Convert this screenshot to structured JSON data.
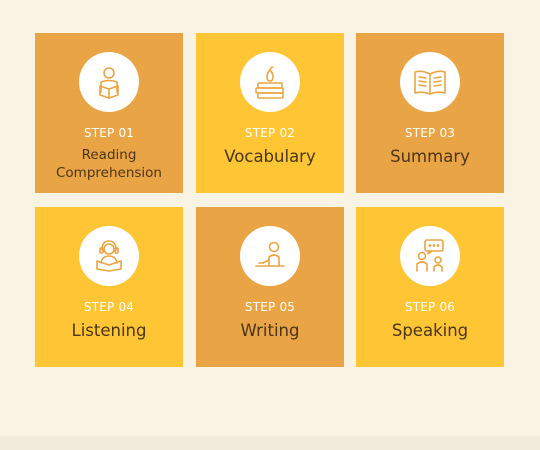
{
  "steps": [
    {
      "step": "STEP 01",
      "title_line1": "Reading",
      "title_line2": "Comprehension",
      "icon": "reading-person-icon",
      "color": "#e9a545"
    },
    {
      "step": "STEP 02",
      "title": "Vocabulary",
      "icon": "books-apple-icon",
      "color": "#fec535"
    },
    {
      "step": "STEP 03",
      "title": "Summary",
      "icon": "open-book-icon",
      "color": "#e9a545"
    },
    {
      "step": "STEP 04",
      "title": "Listening",
      "icon": "headphones-person-icon",
      "color": "#fec535"
    },
    {
      "step": "STEP 05",
      "title": "Writing",
      "icon": "writing-person-icon",
      "color": "#e9a545"
    },
    {
      "step": "STEP 06",
      "title": "Speaking",
      "icon": "speaking-people-icon",
      "color": "#fec535"
    }
  ],
  "colors": {
    "background": "#f8f3e2",
    "orange": "#e9a545",
    "yellow": "#fec535",
    "icon_stroke": "#e9a545"
  }
}
